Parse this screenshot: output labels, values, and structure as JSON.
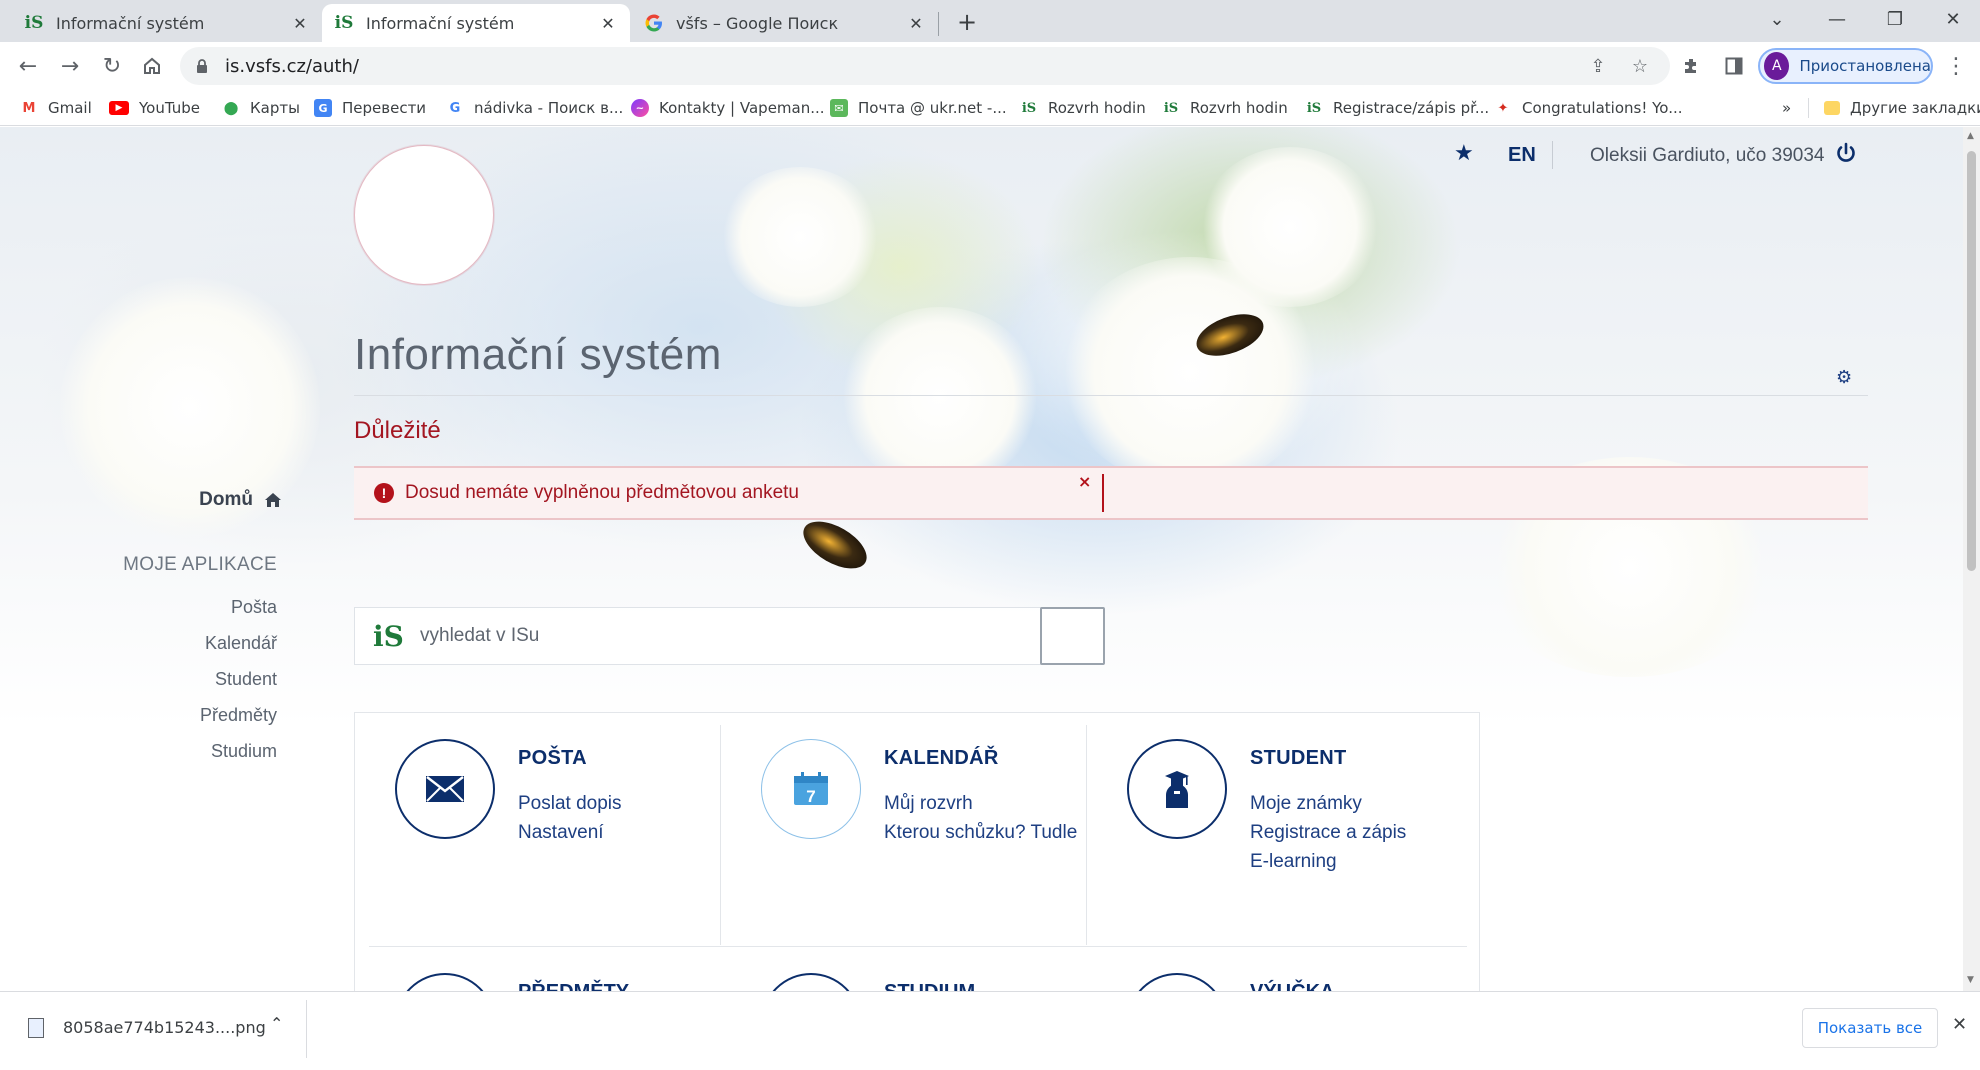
{
  "browser": {
    "tabs": [
      {
        "title": "Informační systém",
        "favicon": "is-logo-icon",
        "active": false
      },
      {
        "title": "Informační systém",
        "favicon": "is-logo-icon",
        "active": true
      },
      {
        "title": "všfs – Google Поиск",
        "favicon": "google-icon",
        "active": false
      }
    ],
    "new_tab_label": "+",
    "url": "is.vsfs.cz/auth/",
    "profile_initial": "A",
    "profile_label": "Приостановлена",
    "bookmarks": [
      {
        "label": "Gmail",
        "icon": "gmail-icon"
      },
      {
        "label": "YouTube",
        "icon": "youtube-icon"
      },
      {
        "label": "Карты",
        "icon": "maps-icon"
      },
      {
        "label": "Перевести",
        "icon": "translate-icon"
      },
      {
        "label": "nádivka - Поиск в...",
        "icon": "google-icon"
      },
      {
        "label": "Kontakty | Vapeman...",
        "icon": "messenger-icon"
      },
      {
        "label": "Почта @ ukr.net -...",
        "icon": "mail-icon"
      },
      {
        "label": "Rozvrh hodin",
        "icon": "is-logo-icon"
      },
      {
        "label": "Rozvrh hodin",
        "icon": "is-logo-icon"
      },
      {
        "label": "Registrace/zápis př...",
        "icon": "is-logo-icon"
      },
      {
        "label": "Congratulations! Yo...",
        "icon": "maple-leaf-icon"
      }
    ],
    "bookmarks_more": "»",
    "other_bookmarks": "Другие закладки"
  },
  "site": {
    "lang_switch": "EN",
    "user": "Oleksii Gardiuto, učo 39034",
    "title": "Informační systém",
    "important_heading": "Důležité",
    "alert_text": "Dosud nemáte vyplněnou předmětovou anketu",
    "alert_icon_text": "!",
    "alert_close": "×",
    "search_placeholder": "vyhledat v ISu",
    "search_logo": "iS"
  },
  "sidebar": {
    "home": "Domů",
    "heading": "MOJE APLIKACE",
    "items": [
      "Pošta",
      "Kalendář",
      "Student",
      "Předměty",
      "Studium"
    ]
  },
  "cards": [
    {
      "title": "POŠTA",
      "icon": "envelope-icon",
      "links": [
        "Poslat dopis",
        "Nastavení"
      ]
    },
    {
      "title": "KALENDÁŘ",
      "icon": "calendar-icon",
      "icon_text": "7",
      "links": [
        "Můj rozvrh",
        "Kterou schůzku? Tudle"
      ]
    },
    {
      "title": "STUDENT",
      "icon": "student-icon",
      "links": [
        "Moje známky",
        "Registrace a zápis",
        "E-learning"
      ]
    }
  ],
  "cards_row2": [
    {
      "title": "PŘEDMĚTY"
    },
    {
      "title": "STUDIUM"
    },
    {
      "title": "VÝUČKA"
    }
  ],
  "downloads": {
    "file_name": "8058ae774b15243....png",
    "show_all": "Показать все"
  },
  "colors": {
    "brand_navy": "#0c2e6b",
    "alert_red": "#a31621",
    "alert_bg": "#fbf1f1",
    "is_green": "#1f7a3a"
  }
}
